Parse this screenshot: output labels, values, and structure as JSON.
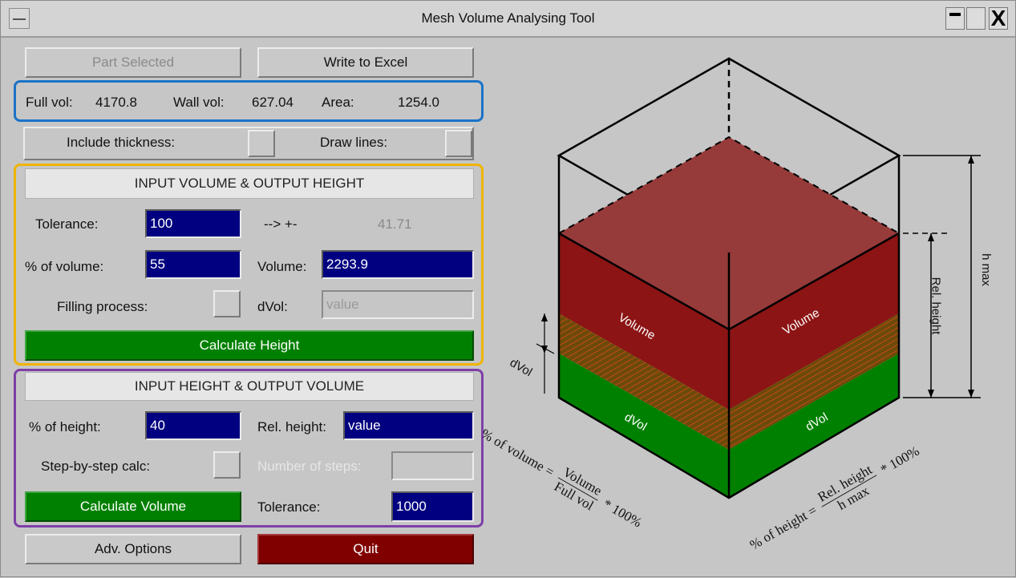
{
  "window": {
    "title": "Mesh Volume Analysing Tool",
    "close_glyph": "X"
  },
  "top": {
    "part_selected": "Part Selected",
    "write_excel": "Write to Excel"
  },
  "stats": {
    "full_vol_label": "Full vol:",
    "full_vol": "4170.8",
    "wall_vol_label": "Wall vol:",
    "wall_vol": "627.04",
    "area_label": "Area:",
    "area": "1254.0"
  },
  "options": {
    "include_thickness": "Include thickness:",
    "draw_lines": "Draw lines:"
  },
  "volume_section": {
    "header": "INPUT VOLUME & OUTPUT HEIGHT",
    "tolerance_label": "Tolerance:",
    "tolerance": "100",
    "arrow_label": "--> +-",
    "arrow_value": "41.71",
    "pct_volume_label": "% of volume:",
    "pct_volume": "55",
    "volume_label": "Volume:",
    "volume": "2293.9",
    "filling_label": "Filling process:",
    "dvol_label": "dVol:",
    "dvol_placeholder": "value",
    "calc_button": "Calculate Height"
  },
  "height_section": {
    "header": "INPUT HEIGHT & OUTPUT VOLUME",
    "pct_height_label": "% of height:",
    "pct_height": "40",
    "rel_height_label": "Rel. height:",
    "rel_height": "value",
    "step_label": "Step-by-step calc:",
    "num_steps_label": "Number of steps:",
    "calc_button": "Calculate Volume",
    "tolerance_label": "Tolerance:",
    "tolerance": "1000"
  },
  "bottom": {
    "adv_options": "Adv. Options",
    "quit": "Quit"
  },
  "diagram": {
    "volume_left": "Volume",
    "volume_right": "Volume",
    "dvol_left": "dVol",
    "dvol_right": "dVol",
    "dvol_side": "dVol",
    "h_max": "h max",
    "rel_height": "Rel. height",
    "formula_vol_lhs": "% of volume =",
    "formula_vol_num": "Volume",
    "formula_vol_den": "Full vol",
    "formula_vol_tail": "* 100%",
    "formula_h_lhs": "% of height =",
    "formula_h_num": "Rel. height",
    "formula_h_den": "h max",
    "formula_h_tail": "* 100%"
  },
  "colors": {
    "frame_blue": "#1a73c8",
    "frame_orange": "#f0b400",
    "frame_purple": "#7d3fa8",
    "field_bg": "#000080",
    "green": "#008000",
    "red": "#800000"
  }
}
